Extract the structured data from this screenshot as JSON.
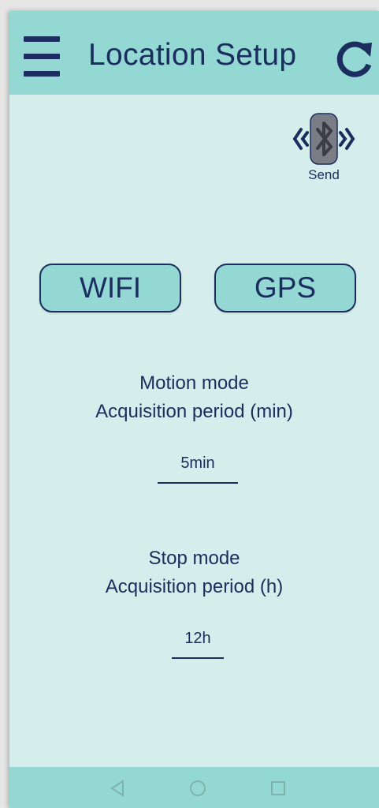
{
  "header": {
    "title": "Location Setup",
    "menu_icon": "hamburger-menu-icon",
    "refresh_icon": "refresh-icon"
  },
  "bluetooth": {
    "label": "Send",
    "icon": "bluetooth-icon"
  },
  "mode_buttons": {
    "wifi_label": "WIFI",
    "gps_label": "GPS"
  },
  "motion_mode": {
    "title": "Motion mode",
    "subtitle": "Acquisition period (min)",
    "value": "5min"
  },
  "stop_mode": {
    "title": "Stop mode",
    "subtitle": "Acquisition period (h)",
    "value": "12h"
  },
  "navbar": {
    "back_icon": "back-triangle-icon",
    "home_icon": "home-circle-icon",
    "recents_icon": "recents-square-icon"
  },
  "colors": {
    "accent": "#93d8d2",
    "background": "#d5eeeb",
    "text": "#1c2e60"
  }
}
